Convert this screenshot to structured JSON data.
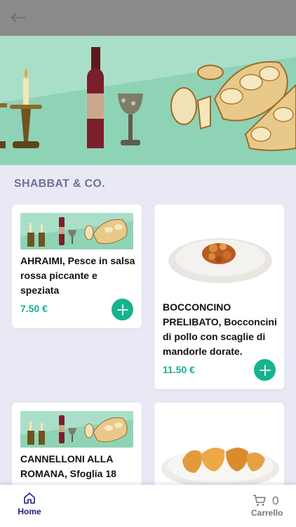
{
  "section": {
    "title": "SHABBAT & CO."
  },
  "products": [
    {
      "title": "AHRAIMI, Pesce in salsa rossa piccante e speziata",
      "price": "7.50 €"
    },
    {
      "title": "BOCCONCINO PRELIBATO, Bocconcini di pollo con scaglie di mandorle dorate.",
      "price": "11.50 €"
    },
    {
      "title": "CANNELLONI ALLA ROMANA, Sfoglia 18",
      "price": ""
    },
    {
      "title": "",
      "price": ""
    }
  ],
  "nav": {
    "home_label": "Home",
    "cart_label": "Carrello",
    "cart_count": "0"
  },
  "icons": {
    "back": "back-arrow-icon",
    "home": "home-icon",
    "cart": "cart-icon",
    "add": "plus-icon"
  },
  "colors": {
    "accent": "#15b48e",
    "header": "#8a8a8a",
    "background": "#e8e9f5",
    "nav_active": "#1a237e"
  }
}
